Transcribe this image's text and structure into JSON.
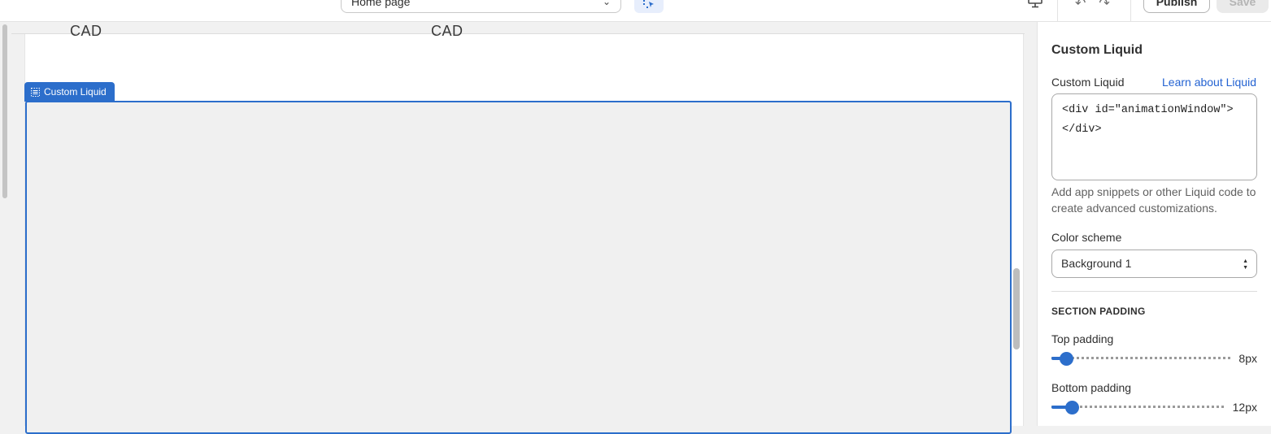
{
  "topbar": {
    "page_select": "Home page",
    "publish_label": "Publish",
    "save_label": "Save",
    "icons": [
      "chevron-down-icon",
      "inspector-icon",
      "desktop-monitor-icon",
      "undo-icon",
      "redo-icon"
    ]
  },
  "preview": {
    "price_left": "CAD",
    "price_right": "CAD",
    "section_tag": "Custom Liquid",
    "accent_color": "#2c6ecb"
  },
  "panel": {
    "title": "Custom Liquid",
    "liquid_label": "Custom Liquid",
    "learn_link": "Learn about Liquid",
    "code_value": "<div id=\"animationWindow\">\n</div>",
    "help_text": "Add app snippets or other Liquid code to create advanced customizations.",
    "color_scheme_label": "Color scheme",
    "color_scheme_value": "Background 1",
    "section_padding_heading": "SECTION PADDING",
    "top_padding_label": "Top padding",
    "top_padding_value": "8px",
    "top_padding_fraction": 0.08,
    "bottom_padding_label": "Bottom padding",
    "bottom_padding_value": "12px",
    "bottom_padding_fraction": 0.12
  }
}
